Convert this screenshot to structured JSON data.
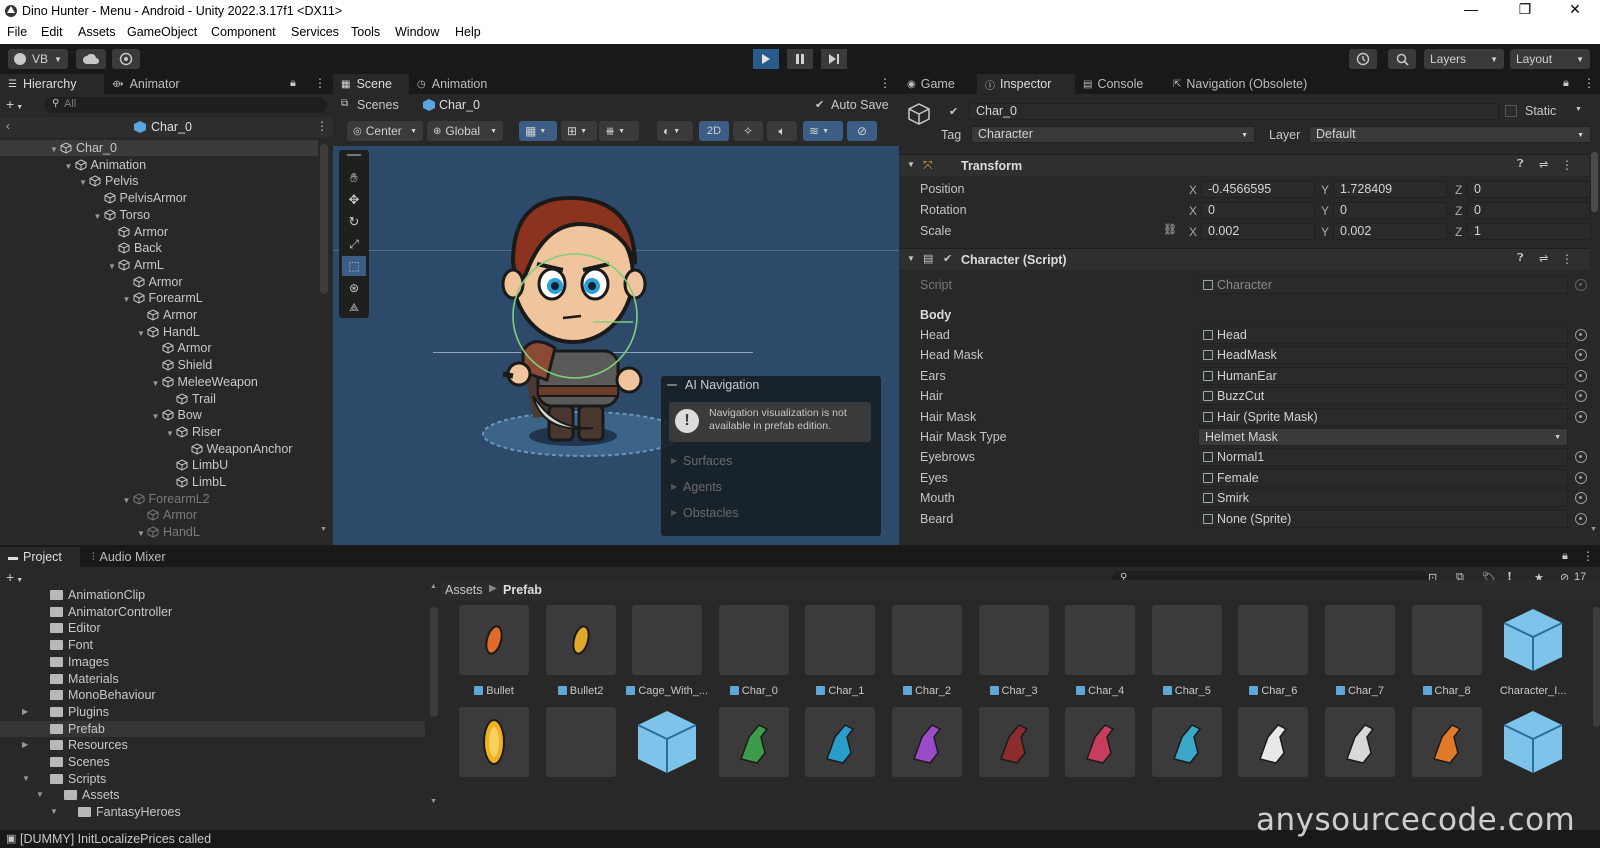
{
  "window": {
    "title": "Dino Hunter - Menu - Android - Unity 2022.3.17f1 <DX11>",
    "controls": {
      "minimize": "—",
      "maximize": "❐",
      "close": "✕"
    }
  },
  "menu": [
    "File",
    "Edit",
    "Assets",
    "GameObject",
    "Component",
    "Services",
    "Tools",
    "Window",
    "Help"
  ],
  "toolbar": {
    "account": "VB",
    "layers": "Layers",
    "layout": "Layout"
  },
  "hierarchy": {
    "tabs": [
      "Hierarchy",
      "Animator"
    ],
    "search_placeholder": "All",
    "prefab_name": "Char_0",
    "items": [
      {
        "label": "Char_0",
        "depth": 0,
        "dim": false
      },
      {
        "label": "Animation",
        "depth": 1,
        "dim": false
      },
      {
        "label": "Pelvis",
        "depth": 2,
        "dim": false
      },
      {
        "label": "PelvisArmor",
        "depth": 3,
        "dim": false
      },
      {
        "label": "Torso",
        "depth": 3,
        "dim": false
      },
      {
        "label": "Armor",
        "depth": 4,
        "dim": false
      },
      {
        "label": "Back",
        "depth": 4,
        "dim": false
      },
      {
        "label": "ArmL",
        "depth": 4,
        "dim": false
      },
      {
        "label": "Armor",
        "depth": 5,
        "dim": false
      },
      {
        "label": "ForearmL",
        "depth": 5,
        "dim": false
      },
      {
        "label": "Armor",
        "depth": 6,
        "dim": false
      },
      {
        "label": "HandL",
        "depth": 6,
        "dim": false
      },
      {
        "label": "Armor",
        "depth": 7,
        "dim": false
      },
      {
        "label": "Shield",
        "depth": 7,
        "dim": false
      },
      {
        "label": "MeleeWeapon",
        "depth": 7,
        "dim": false
      },
      {
        "label": "Trail",
        "depth": 8,
        "dim": false
      },
      {
        "label": "Bow",
        "depth": 7,
        "dim": false
      },
      {
        "label": "Riser",
        "depth": 8,
        "dim": false
      },
      {
        "label": "WeaponAnchor",
        "depth": 9,
        "dim": false
      },
      {
        "label": "LimbU",
        "depth": 8,
        "dim": false
      },
      {
        "label": "LimbL",
        "depth": 8,
        "dim": false
      },
      {
        "label": "ForearmL2",
        "depth": 5,
        "dim": true
      },
      {
        "label": "Armor",
        "depth": 6,
        "dim": true
      },
      {
        "label": "HandL",
        "depth": 6,
        "dim": true
      }
    ]
  },
  "scene": {
    "tabs": [
      "Scene",
      "Animation"
    ],
    "breadcrumb": {
      "root": "Scenes",
      "current": "Char_0"
    },
    "auto_save": "Auto Save",
    "pivot": "Center",
    "space": "Global",
    "mode_2d": "2D",
    "overlay": {
      "title": "AI Navigation",
      "warning": "Navigation visualization is not available in prefab edition.",
      "items": [
        "Surfaces",
        "Agents",
        "Obstacles"
      ]
    }
  },
  "inspector": {
    "tabs": [
      "Game",
      "Inspector",
      "Console",
      "Navigation (Obsolete)"
    ],
    "object_name": "Char_0",
    "static_label": "Static",
    "tag_label": "Tag",
    "tag_value": "Character",
    "layer_label": "Layer",
    "layer_value": "Default",
    "transform": {
      "title": "Transform",
      "position_label": "Position",
      "rotation_label": "Rotation",
      "scale_label": "Scale",
      "position": {
        "x": "-0.4566595",
        "y": "1.728409",
        "z": "0"
      },
      "rotation": {
        "x": "0",
        "y": "0",
        "z": "0"
      },
      "scale": {
        "x": "0.002",
        "y": "0.002",
        "z": "1"
      }
    },
    "character": {
      "title": "Character (Script)",
      "script_label": "Script",
      "script_value": "Character",
      "section": "Body",
      "fields": [
        {
          "label": "Head",
          "value": "Head"
        },
        {
          "label": "Head Mask",
          "value": "HeadMask"
        },
        {
          "label": "Ears",
          "value": "HumanEar"
        },
        {
          "label": "Hair",
          "value": "BuzzCut"
        },
        {
          "label": "Hair Mask",
          "value": "Hair (Sprite Mask)"
        },
        {
          "label": "Hair Mask Type",
          "value": "Helmet Mask"
        },
        {
          "label": "Eyebrows",
          "value": "Normal1"
        },
        {
          "label": "Eyes",
          "value": "Female"
        },
        {
          "label": "Mouth",
          "value": "Smirk"
        },
        {
          "label": "Beard",
          "value": "None (Sprite)"
        }
      ]
    }
  },
  "project": {
    "tabs": [
      "Project",
      "Audio Mixer"
    ],
    "hidden_count": "17",
    "breadcrumb": {
      "root": "Assets",
      "current": "Prefab"
    },
    "folders": [
      {
        "label": "AnimationClip",
        "depth": 0
      },
      {
        "label": "AnimatorController",
        "depth": 0
      },
      {
        "label": "Editor",
        "depth": 0
      },
      {
        "label": "Font",
        "depth": 0
      },
      {
        "label": "Images",
        "depth": 0
      },
      {
        "label": "Materials",
        "depth": 0
      },
      {
        "label": "MonoBehaviour",
        "depth": 0
      },
      {
        "label": "Plugins",
        "depth": 0
      },
      {
        "label": "Prefab",
        "depth": 0
      },
      {
        "label": "Resources",
        "depth": 0
      },
      {
        "label": "Scenes",
        "depth": 0
      },
      {
        "label": "Scripts",
        "depth": 0
      },
      {
        "label": "Assets",
        "depth": 1
      },
      {
        "label": "FantasyHeroes",
        "depth": 2
      }
    ],
    "assets_row1": [
      "Bullet",
      "Bullet2",
      "Cage_With_...",
      "Char_0",
      "Char_1",
      "Char_2",
      "Char_3",
      "Char_4",
      "Char_5",
      "Char_6",
      "Char_7",
      "Char_8",
      "Character_I..."
    ]
  },
  "status": {
    "message": "[DUMMY] InitLocalizePrices called",
    "watermark": "anysourcecode.com"
  },
  "colors": {
    "scene_bg": "#2d4a6a",
    "accent": "#3a79bb",
    "panel": "#282828"
  }
}
